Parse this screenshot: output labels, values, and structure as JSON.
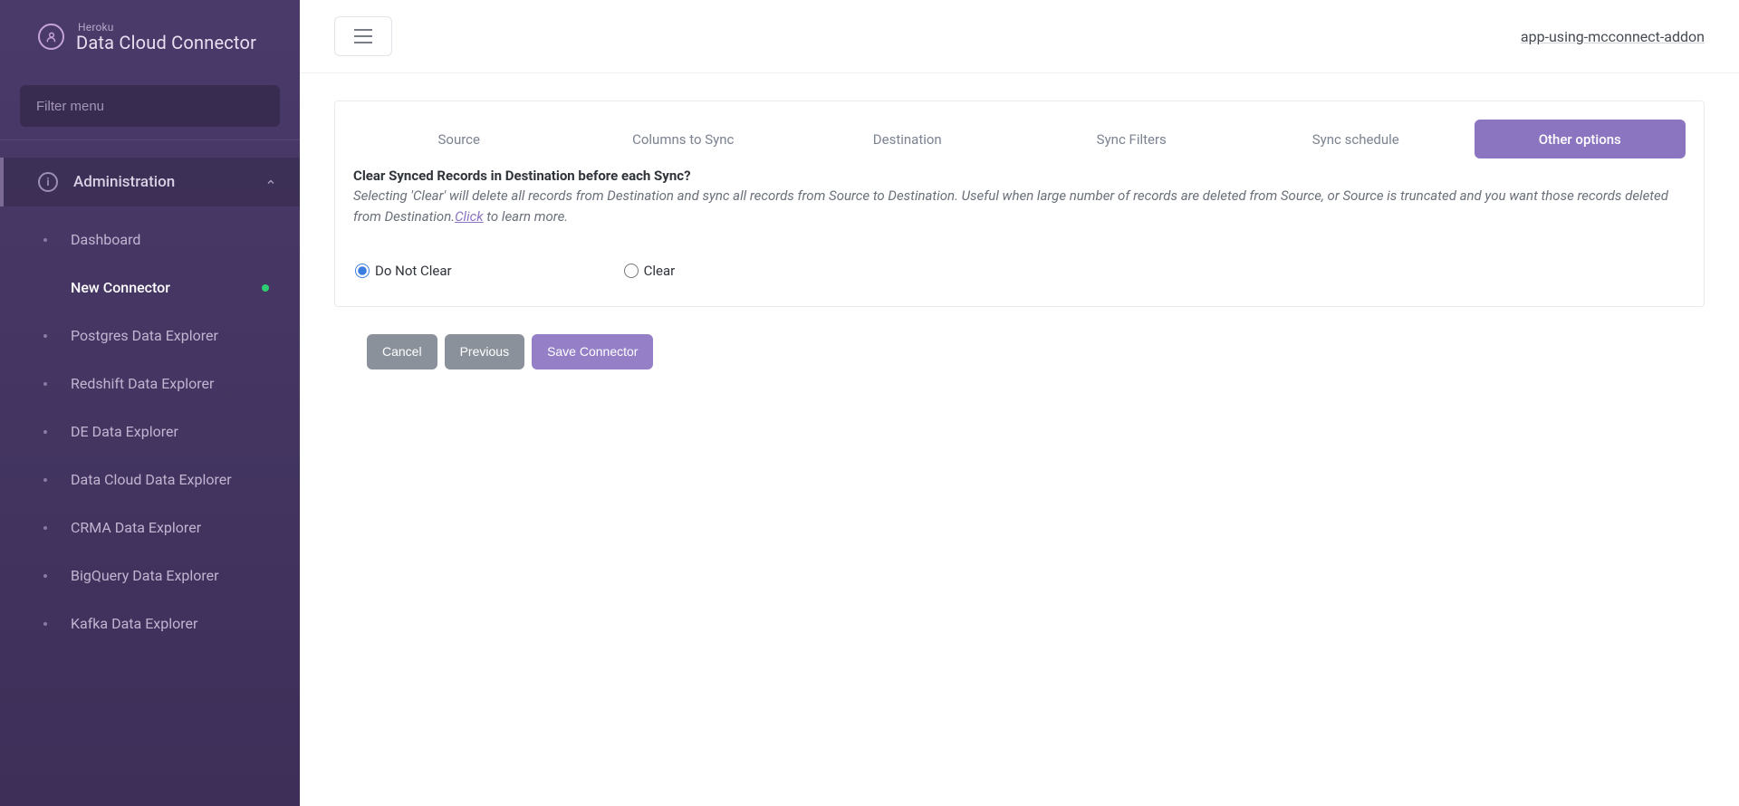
{
  "header": {
    "company": "Heroku",
    "product": "Data Cloud Connector"
  },
  "sidebar": {
    "filter_placeholder": "Filter menu",
    "section": "Administration",
    "items": [
      {
        "label": "Dashboard",
        "active": false
      },
      {
        "label": "New Connector",
        "active": true,
        "badge": true
      },
      {
        "label": "Postgres Data Explorer",
        "active": false
      },
      {
        "label": "Redshift Data Explorer",
        "active": false
      },
      {
        "label": "DE Data Explorer",
        "active": false
      },
      {
        "label": "Data Cloud Data Explorer",
        "active": false
      },
      {
        "label": "CRMA Data Explorer",
        "active": false
      },
      {
        "label": "BigQuery Data Explorer",
        "active": false
      },
      {
        "label": "Kafka Data Explorer",
        "active": false
      }
    ]
  },
  "topbar": {
    "app_name": "app-using-mcconnect-addon"
  },
  "tabs": [
    {
      "label": "Source",
      "active": false
    },
    {
      "label": "Columns to Sync",
      "active": false
    },
    {
      "label": "Destination",
      "active": false
    },
    {
      "label": "Sync Filters",
      "active": false
    },
    {
      "label": "Sync schedule",
      "active": false
    },
    {
      "label": "Other options",
      "active": true
    }
  ],
  "form": {
    "question": "Clear Synced Records in Destination before each Sync?",
    "desc_prefix": "Selecting 'Clear' will delete all records from Destination and sync all records from Source to Destination. Useful when large number of records are deleted from Source, or Source is truncated and you want those records deleted from Destination.",
    "desc_link": "Click",
    "desc_suffix": " to learn more.",
    "radio1": "Do Not Clear",
    "radio2": "Clear"
  },
  "buttons": {
    "cancel": "Cancel",
    "previous": "Previous",
    "save": "Save Connector"
  }
}
